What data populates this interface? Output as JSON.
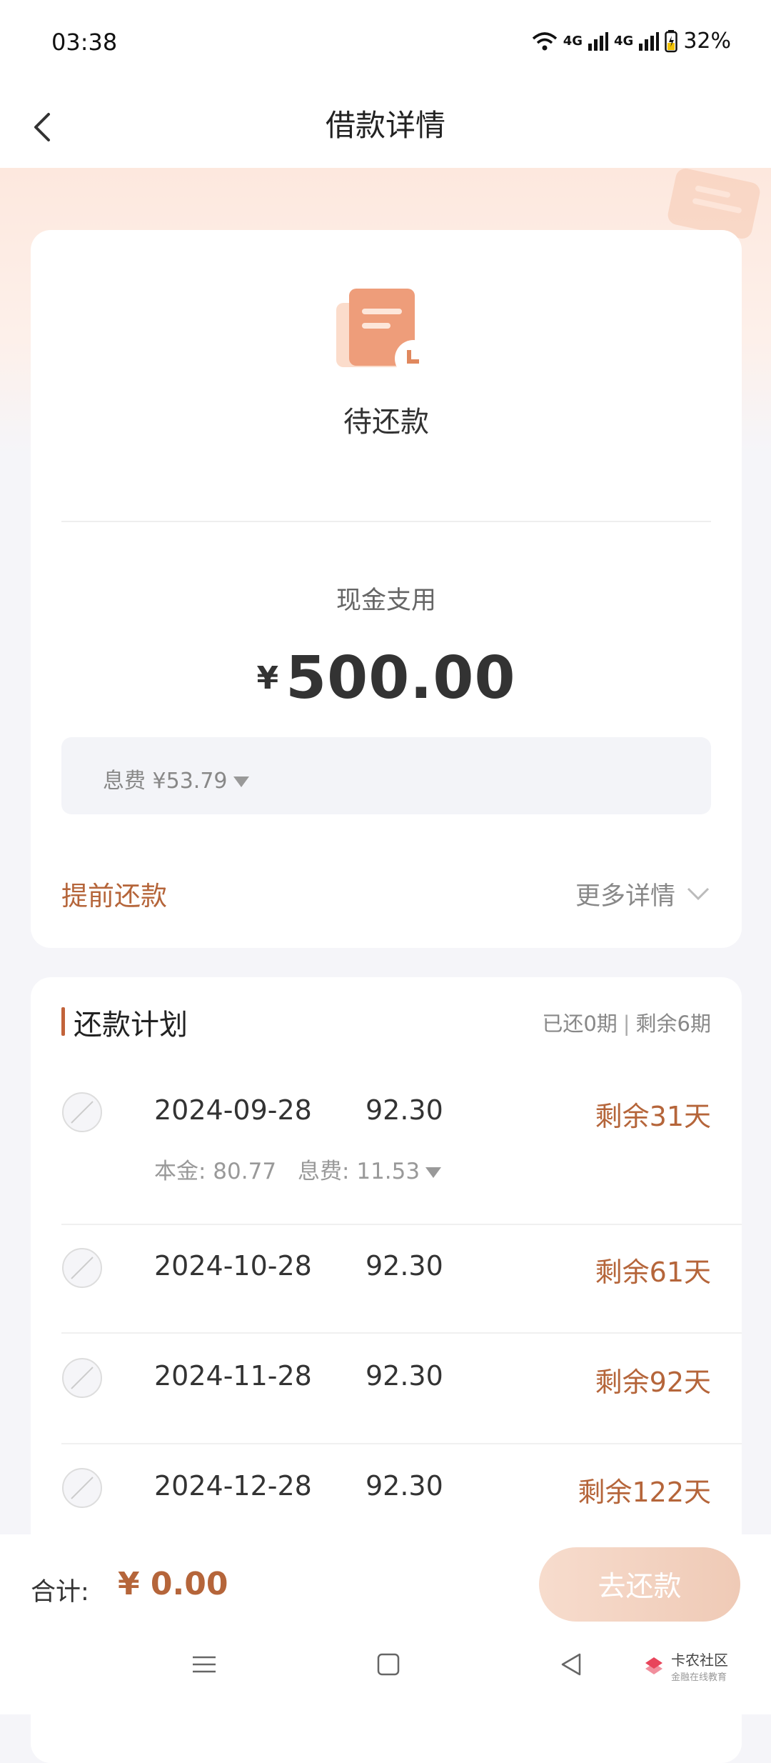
{
  "status_bar": {
    "time": "03:38",
    "battery": "32%",
    "signal_1": "4G",
    "signal_2": "4G"
  },
  "header": {
    "title": "借款详情"
  },
  "loan": {
    "status": "待还款",
    "cash_label": "现金支用",
    "currency": "¥",
    "amount": "500.00",
    "fee_label": "息费 ¥53.79",
    "prepay_label": "提前还款",
    "more_details_label": "更多详情"
  },
  "plan": {
    "title": "还款计划",
    "paid": "已还0期",
    "separator": "|",
    "remaining": "剩余6期",
    "rows": [
      {
        "date": "2024-09-28",
        "amount": "92.30",
        "remain": "剩余31天",
        "principal": "本金: 80.77",
        "fee": "息费: 11.53"
      },
      {
        "date": "2024-10-28",
        "amount": "92.30",
        "remain": "剩余61天"
      },
      {
        "date": "2024-11-28",
        "amount": "92.30",
        "remain": "剩余92天"
      },
      {
        "date": "2024-12-28",
        "amount": "92.30",
        "remain": "剩余122天"
      }
    ]
  },
  "footer": {
    "total_label": "合计:",
    "total_value": "¥ 0.00",
    "pay_button": "去还款"
  },
  "watermark": {
    "line1": "卡农社区",
    "line2": "金融在线教育"
  },
  "colors": {
    "accent": "#b5653a",
    "button_bg": "#f3d3c1",
    "page_bg": "#f5f5f9"
  }
}
